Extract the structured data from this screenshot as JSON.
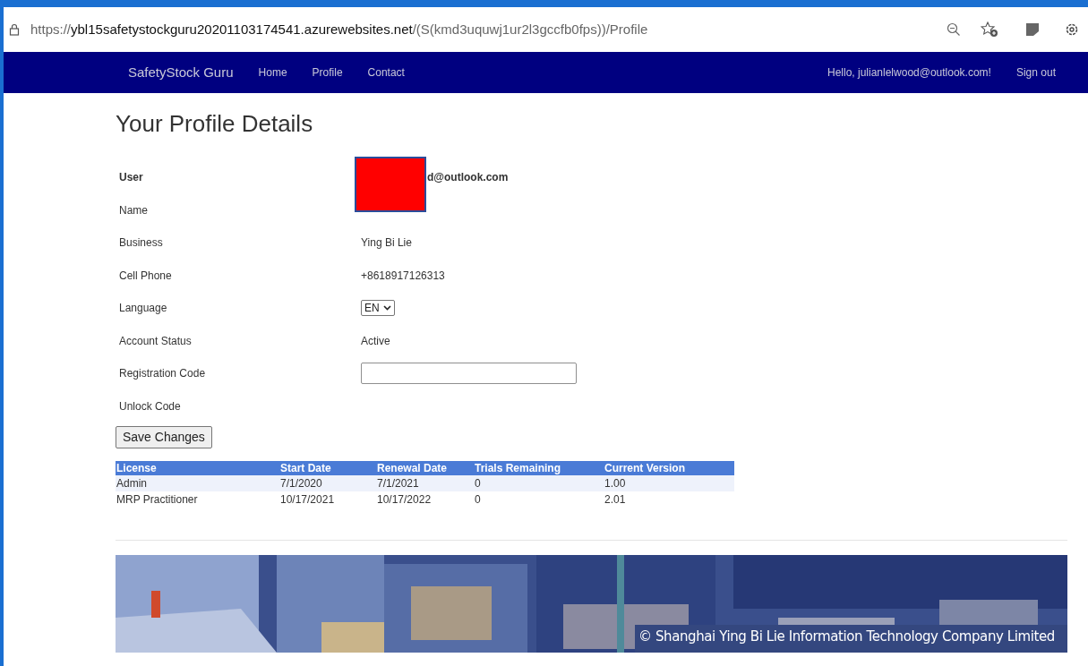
{
  "browser": {
    "url": "https://**ybl15safetystockguru20201103174541.azurewebsites.net**/(S(kmd3uquwj1ur2l3gccfb0fps))/Profile"
  },
  "navbar": {
    "brand": "SafetyStock Guru",
    "links": [
      "Home",
      "Profile",
      "Contact"
    ],
    "greeting": "Hello, julianlelwood@outlook.com!",
    "sign_out": "Sign out"
  },
  "title": "Your Profile Details",
  "fields": [
    {
      "kind": "redacted",
      "label": "User",
      "value": "d@outlook.com"
    },
    {
      "kind": "none",
      "label": "Name"
    },
    {
      "kind": "text",
      "label": "Business",
      "value": "Ying Bi Lie"
    },
    {
      "kind": "text",
      "label": "Cell Phone",
      "value": "+8618917126313"
    },
    {
      "kind": "select",
      "label": "Language",
      "value": "EN"
    },
    {
      "kind": "text",
      "label": "Account Status",
      "value": "Active"
    },
    {
      "kind": "input",
      "label": "Registration Code"
    },
    {
      "kind": "none",
      "label": "Unlock Code"
    }
  ],
  "save_button": "Save Changes",
  "licenses": {
    "columns": [
      "License",
      "Start Date",
      "Renewal Date",
      "Trials Remaining",
      "Current Version"
    ],
    "rows": [
      [
        "Admin",
        "7/1/2020",
        "7/1/2021",
        "0",
        "1.00"
      ],
      [
        "MRP Practitioner",
        "10/17/2021",
        "10/17/2022",
        "0",
        "2.01"
      ]
    ]
  },
  "footer": {
    "copyright": "© Shanghai Ying Bi Lie Information Technology Company Limited"
  }
}
